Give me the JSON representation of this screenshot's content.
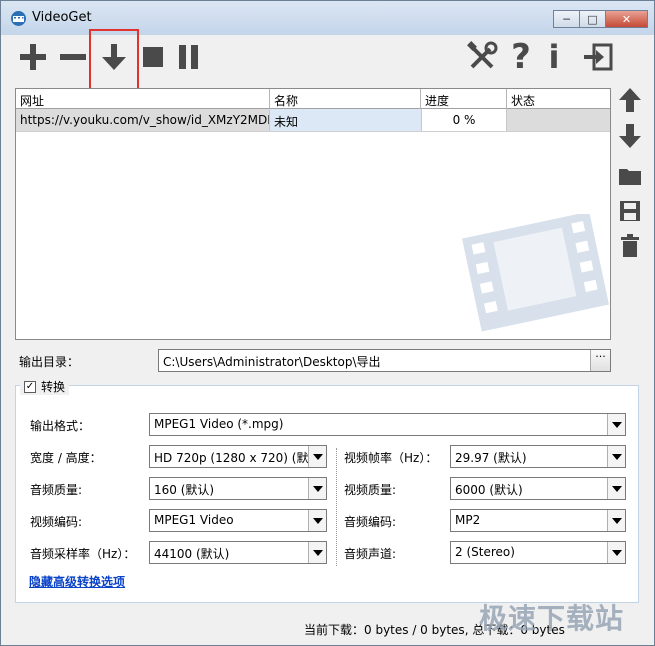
{
  "window": {
    "title": "VideoGet",
    "minimize": "─",
    "maximize": "□",
    "close": "✕"
  },
  "toolbar": {
    "items": [
      "add-icon",
      "remove-icon",
      "download-icon",
      "stop-icon",
      "pause-icon",
      "settings-tools-icon",
      "help-icon",
      "info-icon",
      "exit-icon"
    ],
    "help_glyph": "?",
    "info_glyph": "i"
  },
  "grid": {
    "headers": [
      "网址",
      "名称",
      "进度",
      "状态"
    ],
    "rows": [
      {
        "url": "https://v.youku.com/v_show/id_XMzY2MDI",
        "name": "未知",
        "progress": "0 %",
        "status": ""
      }
    ]
  },
  "output": {
    "label": "输出目录：",
    "path": "C:\\Users\\Administrator\\Desktop\\导出",
    "browse": "···"
  },
  "convert": {
    "checkbox_label": "转换",
    "checked": "✓",
    "format_label": "输出格式：",
    "format_value": "MPEG1 Video (*.mpg)",
    "size_label": "宽度 / 高度：",
    "size_value": "HD 720p (1280 x 720) (默认",
    "fps_label": "视频帧率（Hz）：",
    "fps_value": "29.97 (默认)",
    "audio_quality_label": "音频质量:",
    "audio_quality_value": "160 (默认)",
    "video_quality_label": "视频质量:",
    "video_quality_value": "6000 (默认)",
    "video_codec_label": "视频编码:",
    "video_codec_value": "MPEG1 Video",
    "audio_codec_label": "音频编码:",
    "audio_codec_value": "MP2",
    "sample_rate_label": "音频采样率（Hz）：",
    "sample_rate_value": "44100 (默认)",
    "channels_label": "音频声道:",
    "channels_value": "2 (Stereo)",
    "hide_link": "隐藏高级转换选项"
  },
  "status": {
    "text": "当前下载：0 bytes / 0 bytes, 总下载：0 bytes"
  },
  "brand_watermark": "极速下载站",
  "colors": {
    "highlight": "#e2322d",
    "link": "#0a43c8",
    "icon": "#4a4a4a"
  }
}
